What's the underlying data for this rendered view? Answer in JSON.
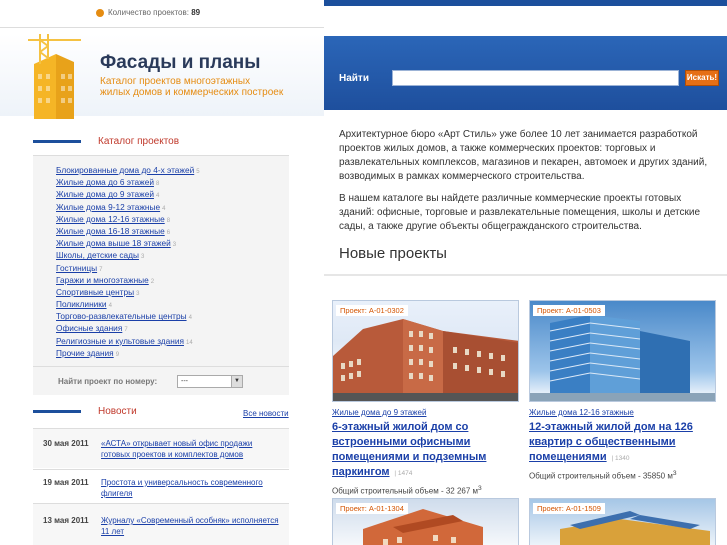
{
  "topbar": {
    "count_label": "Количество проектов:",
    "count_value": "89"
  },
  "header": {
    "title": "Фасады и планы",
    "subtitle_line1": "Каталог проектов многоэтажных",
    "subtitle_line2": "жилых домов и коммерческих построек"
  },
  "search": {
    "label": "Найти",
    "placeholder": "",
    "button": "Искать!"
  },
  "catalog": {
    "title": "Каталог проектов",
    "items": [
      {
        "label": "Блокированные дома до 4-х этажей",
        "count": "5"
      },
      {
        "label": "Жилые дома до 6 этажей",
        "count": "8"
      },
      {
        "label": "Жилые дома до 9 этажей",
        "count": "4"
      },
      {
        "label": "Жилые дома 9-12 этажные",
        "count": "4"
      },
      {
        "label": "Жилые дома 12-16 этажные",
        "count": "8"
      },
      {
        "label": "Жилые дома 16-18 этажные",
        "count": "6"
      },
      {
        "label": "Жилые дома выше 18 этажей",
        "count": "3"
      },
      {
        "label": "Школы, детские сады",
        "count": "3"
      },
      {
        "label": "Гостиницы",
        "count": "7"
      },
      {
        "label": "Гаражи и многоэтажные",
        "count": "2"
      },
      {
        "label": "Спортивные центры",
        "count": "3"
      },
      {
        "label": "Поликлиники",
        "count": "4"
      },
      {
        "label": "Торгово-развлекательные центры",
        "count": "4"
      },
      {
        "label": "Офисные здания",
        "count": "7"
      },
      {
        "label": "Религиозные и культовые здания",
        "count": "14"
      },
      {
        "label": "Прочие здания",
        "count": "9"
      }
    ],
    "find_label": "Найти проект по номеру:",
    "find_select": "---"
  },
  "news": {
    "title": "Новости",
    "all_link": "Все новости",
    "items": [
      {
        "date": "30 мая 2011",
        "text": "«АСТА» открывает новый офис продажи готовых проектов и комплектов домов"
      },
      {
        "date": "19 мая 2011",
        "text": "Простота и универсальность современного флигеля"
      },
      {
        "date": "13 мая 2011",
        "text": "Журналу «Современный особняк» исполняется 11 лет"
      }
    ]
  },
  "intro": {
    "p1": "Архитектурное бюро «Арт Стиль» уже более 10 лет занимается разработкой проектов жилых домов, а также коммерческих проектов: торговых и развлекательных комплексов, магазинов и пекарен, автомоек и других зданий, возводимых в рамках коммерческого строительства.",
    "p2": "В нашем каталоге вы найдете различные коммерческие проекты готовых зданий: офисные, торговые и развлекательные помещения, школы и детские сады, а также другие объекты общегражданского строительства."
  },
  "new_projects": {
    "title": "Новые проекты",
    "cards": [
      {
        "tag": "Проект: А-01-0302",
        "category": "Жилые дома до 9 этажей",
        "name": "6-этажный жилой дом со встроенными офисными помещениями и подземным паркингом",
        "num": "1474",
        "volume_label": "Общий строительный объем - 32 267 м",
        "volume_sup": "3"
      },
      {
        "tag": "Проект: А-01-0503",
        "category": "Жилые дома 12-16 этажные",
        "name": "12-этажный жилой дом на 126 квартир с общественными помещениями",
        "num": "1340",
        "volume_label": "Общий строительный объем - 35850 м",
        "volume_sup": "3"
      },
      {
        "tag": "Проект: А-01-1304"
      },
      {
        "tag": "Проект: А-01-1509"
      }
    ]
  },
  "colors": {
    "accent": "#1c4f9c",
    "orange": "#e58c12",
    "link": "#1a3fa8",
    "red_heading": "#c0392b"
  }
}
